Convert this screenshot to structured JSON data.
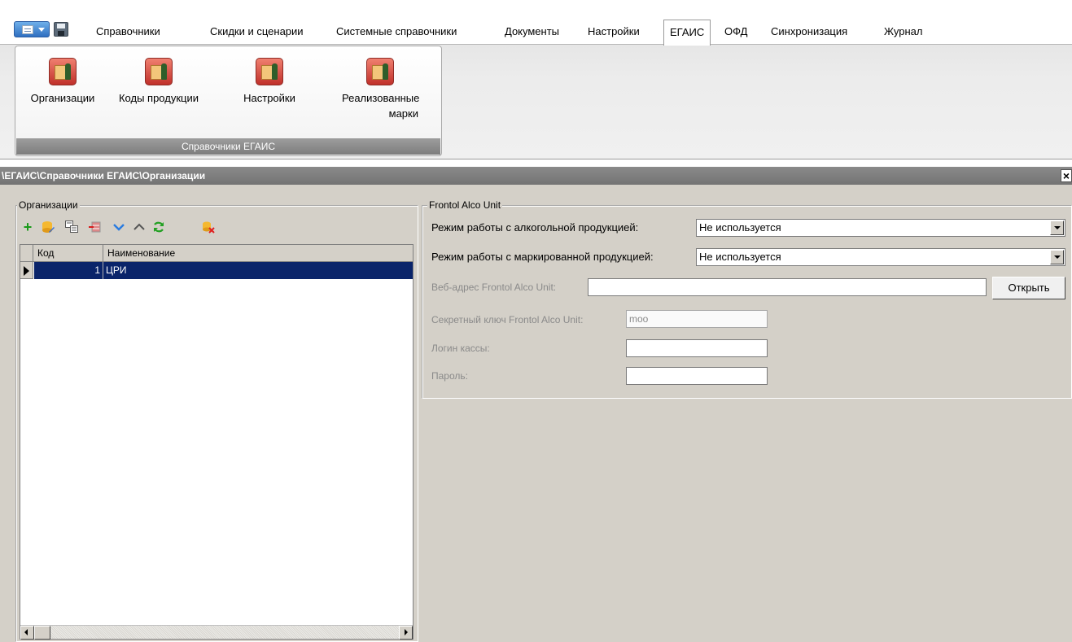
{
  "tabs": [
    "Справочники",
    "Скидки и сценарии",
    "Системные справочники",
    "Документы",
    "Настройки",
    "ЕГАИС",
    "ОФД",
    "Синхронизация",
    "Журнал"
  ],
  "ribbon": {
    "buttons": [
      "Организации",
      "Коды продукции",
      "Настройки",
      "Реализованные марки"
    ],
    "group_caption": "Справочники ЕГАИС"
  },
  "document": {
    "path": "\\ЕГАИС\\Справочники ЕГАИС\\Организации",
    "close_glyph": "×"
  },
  "organizations": {
    "group_title": "Организации",
    "toolbar_icons": [
      "add-icon",
      "edit-icon",
      "copy-icon",
      "delete-icon",
      "move-down-icon",
      "move-up-icon",
      "refresh-icon",
      "clear-filter-icon"
    ],
    "columns": [
      "Код",
      "Наименование"
    ],
    "rows": [
      {
        "code": "1",
        "name": "ЦРИ"
      }
    ]
  },
  "frontol": {
    "group_title": "Frontol Alco Unit",
    "alco_mode_label": "Режим работы с алкогольной продукцией:",
    "alco_mode_value": "Не используется",
    "marked_mode_label": "Режим работы с маркированной продукцией:",
    "marked_mode_value": "Не используется",
    "web_address_label": "Веб-адрес Frontol Alco Unit:",
    "web_address_value": "",
    "open_button": "Открыть",
    "secret_key_label": "Секретный ключ  Frontol Alco Unit:",
    "secret_key_value": "moo",
    "login_label": "Логин кассы:",
    "login_value": "",
    "password_label": "Пароль:",
    "password_value": ""
  },
  "colors": {
    "selection": "#0a246a",
    "workspace": "#d4d0c8",
    "caption": "#7d7d7d"
  }
}
